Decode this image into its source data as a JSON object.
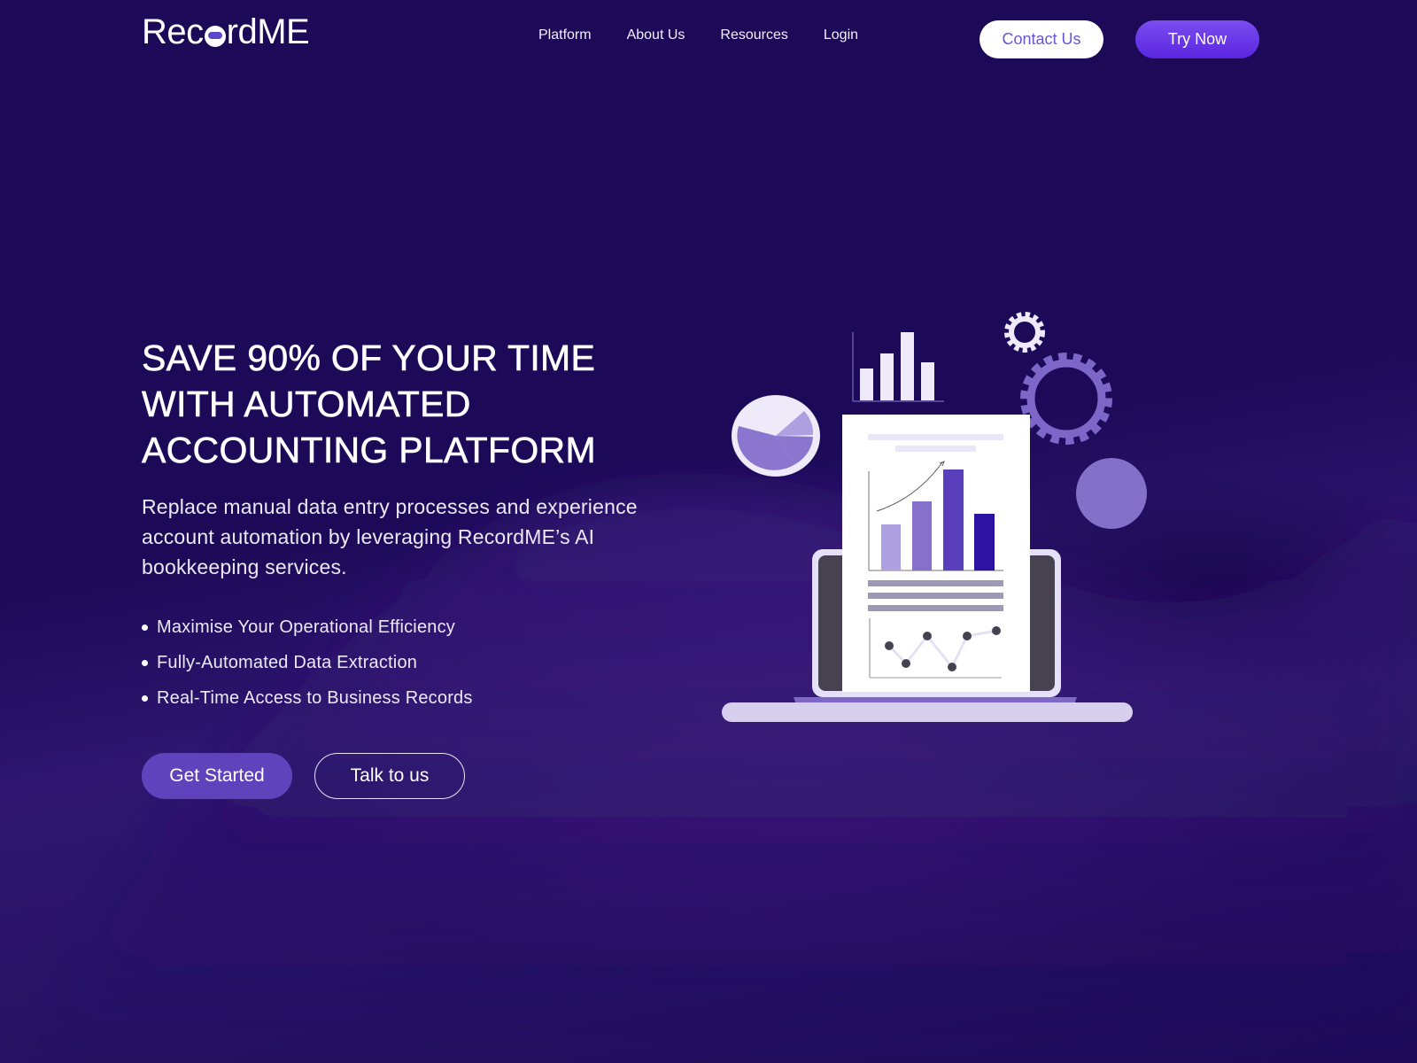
{
  "header": {
    "logo_text_before": "Rec",
    "logo_text_after": "rdME",
    "nav": [
      {
        "label": "Platform"
      },
      {
        "label": "About Us"
      },
      {
        "label": "Resources"
      },
      {
        "label": "Login"
      }
    ],
    "contact_label": "Contact Us",
    "try_label": "Try Now"
  },
  "hero": {
    "title_lines": [
      "SAVE 90% OF YOUR TIME",
      "WITH AUTOMATED",
      "ACCOUNTING PLATFORM"
    ],
    "description": "Replace manual data entry processes and experience account automation by leveraging RecordME’s  AI bookkeeping services.",
    "features": [
      "Maximise Your Operational Efficiency",
      "Fully-Automated Data Extraction",
      "Real-Time Access to Business Records"
    ],
    "primary_cta": "Get Started",
    "secondary_cta": "Talk to us"
  },
  "colors": {
    "background": "#1c0a58",
    "accent": "#6a55d6",
    "primary_button": "#5f43bd",
    "try_button": "#6a3de8"
  }
}
